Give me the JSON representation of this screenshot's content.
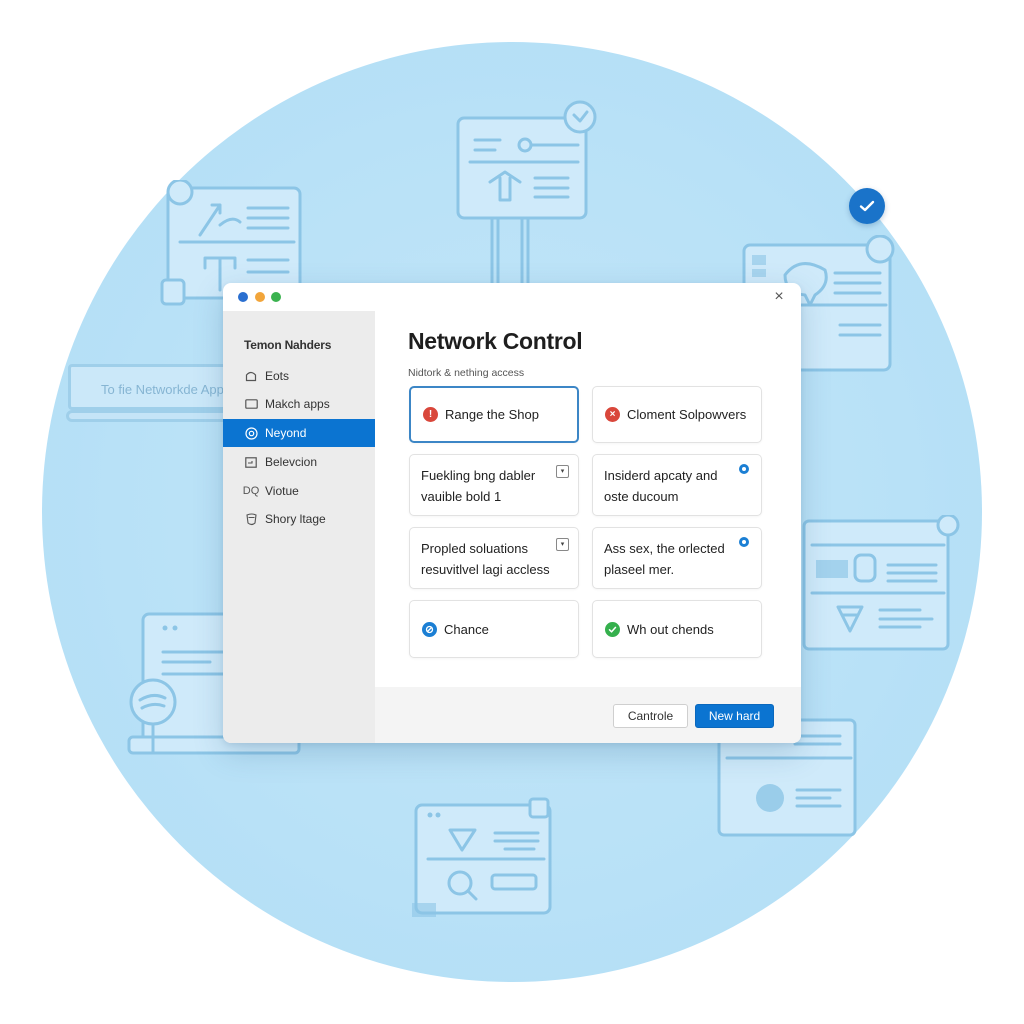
{
  "background": {
    "label_text": "To fie Networkde Apps",
    "badge_icon": "check-icon"
  },
  "window": {
    "controls": [
      "close-dot",
      "minimize-dot",
      "maximize-dot"
    ],
    "close_icon": "×"
  },
  "sidebar": {
    "title": "Temon Nahders",
    "items": [
      {
        "label": "Eots",
        "icon": "home-icon",
        "glyph": "⌂",
        "active": false
      },
      {
        "label": "Makch apps",
        "icon": "window-icon",
        "glyph": "▭",
        "active": false
      },
      {
        "label": "Neyond",
        "icon": "target-icon",
        "glyph": "◎",
        "active": true
      },
      {
        "label": "Belevcion",
        "icon": "panel-icon",
        "glyph": "⊟",
        "active": false
      },
      {
        "label": "Viotue",
        "icon": "dq-icon",
        "glyph": "DQ",
        "active": false
      },
      {
        "label": "Shory ltage",
        "icon": "shield-icon",
        "glyph": "⛉",
        "active": false
      }
    ]
  },
  "main": {
    "title": "Network Control",
    "subtitle": "Nidtork & nething access",
    "cards": [
      {
        "label": "Range the Shop",
        "status": "warning",
        "status_color": "#d9473b",
        "glyph": "!",
        "selected": true
      },
      {
        "label": "Cloment Solpowvers",
        "status": "error",
        "status_color": "#d9473b",
        "glyph": "×",
        "selected": false
      },
      {
        "line1": "Fuekling bng dabler",
        "line2": "vauible bold 1",
        "control": "dropdown",
        "control_glyph": "▾"
      },
      {
        "line1": "Insiderd apcaty and",
        "line2": "oste ducoum",
        "control": "radio"
      },
      {
        "line1": "Propled soluations",
        "line2": "resuvitlvel lagi accless",
        "control": "dropdown",
        "control_glyph": "▾"
      },
      {
        "line1": "Ass sex, the orlected",
        "line2": "plaseel mer.",
        "control": "radio"
      },
      {
        "label": "Chance",
        "status": "info",
        "status_color": "#1b7fd4",
        "glyph": "⊘",
        "selected": false
      },
      {
        "label": "Wh out chends",
        "status": "success",
        "status_color": "#35b04d",
        "glyph": "✓",
        "selected": false
      }
    ]
  },
  "footer": {
    "secondary_label": "Cantrole",
    "primary_label": "New hard"
  },
  "colors": {
    "accent": "#0b74d1",
    "background_circle": "#bce3f7",
    "sidebar_bg": "#ececec",
    "error": "#d9473b",
    "success": "#35b04d"
  }
}
